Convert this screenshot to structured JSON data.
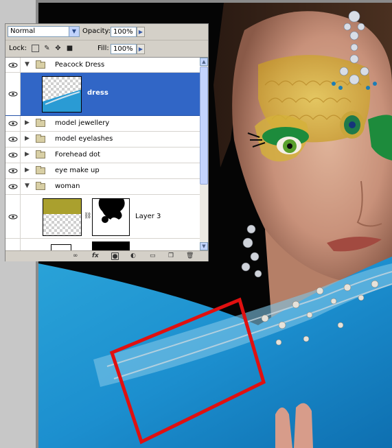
{
  "panel": {
    "blend_mode": "Normal",
    "opacity_label": "Opacity:",
    "opacity_value": "100%",
    "lock_label": "Lock:",
    "fill_label": "Fill:",
    "fill_value": "100%"
  },
  "layers": [
    {
      "name": "Peacock Dress",
      "type": "group",
      "expanded": true,
      "visible": true
    },
    {
      "name": "dress",
      "type": "layer",
      "selected": true,
      "visible": true
    },
    {
      "name": "model jewellery",
      "type": "group",
      "expanded": false,
      "visible": true
    },
    {
      "name": "model eyelashes",
      "type": "group",
      "expanded": false,
      "visible": true
    },
    {
      "name": "Forehead dot",
      "type": "group",
      "expanded": false,
      "visible": true
    },
    {
      "name": "eye make up",
      "type": "group",
      "expanded": false,
      "visible": true
    },
    {
      "name": "woman",
      "type": "group",
      "expanded": true,
      "visible": true
    },
    {
      "name": "Layer 3",
      "type": "layer",
      "has_mask": true,
      "visible": true
    }
  ],
  "bottom_icons": [
    "link-icon",
    "fx-icon",
    "mask-icon",
    "adjustment-icon",
    "new-group-icon",
    "new-layer-icon",
    "trash-icon"
  ],
  "colors": {
    "selection": "#3166c6",
    "panel_bg": "#d4d0c8",
    "highlight_box": "#e01010"
  }
}
